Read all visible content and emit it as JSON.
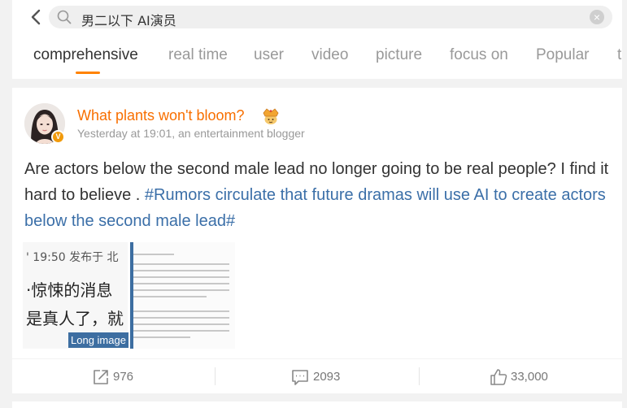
{
  "search": {
    "query": "男二以下 AI演员"
  },
  "tabs": [
    {
      "label": "comprehensive",
      "active": true
    },
    {
      "label": "real time",
      "active": false
    },
    {
      "label": "user",
      "active": false
    },
    {
      "label": "video",
      "active": false
    },
    {
      "label": "picture",
      "active": false
    },
    {
      "label": "focus on",
      "active": false
    },
    {
      "label": "Popular",
      "active": false
    },
    {
      "label": "t",
      "active": false
    }
  ],
  "post": {
    "username": "What plants won't bloom?",
    "meta": "Yesterday at 19:01, an entertainment blogger",
    "text": "Are actors below the second male lead no longer going to be real people? I find it hard to believe .",
    "topic": "#Rumors circulate that future dramas will use AI to create actors below the second male lead#",
    "verified_badge": "V",
    "image1_lines": [
      "' 19:50  发布于 北",
      "·惊悚的消息",
      "是真人了，就"
    ],
    "long_image_label": "Long image",
    "accent_color": "#ff8200",
    "username_color": "#f86f00",
    "topic_color": "#3b6fa8"
  },
  "actions": {
    "repost_count": "976",
    "comment_count": "2093",
    "like_count": "33,000"
  }
}
